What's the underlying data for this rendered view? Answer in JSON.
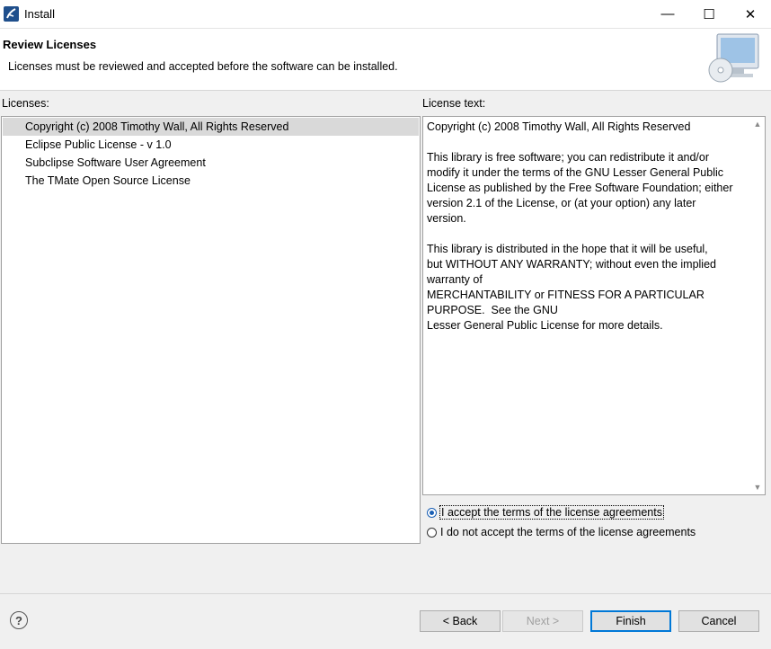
{
  "window": {
    "title": "Install",
    "controls": {
      "minimize": "—",
      "maximize": "☐",
      "close": "✕"
    }
  },
  "header": {
    "title": "Review Licenses",
    "description": "Licenses must be reviewed and accepted before the software can be installed."
  },
  "licenses": {
    "label": "Licenses:",
    "items": [
      {
        "label": "Copyright (c) 2008 Timothy Wall, All Rights Reserved",
        "selected": true
      },
      {
        "label": "Eclipse Public License - v 1.0",
        "selected": false
      },
      {
        "label": "Subclipse Software User Agreement",
        "selected": false
      },
      {
        "label": "The TMate Open Source License",
        "selected": false
      }
    ]
  },
  "license_text": {
    "label": "License text:",
    "content": "Copyright (c) 2008 Timothy Wall, All Rights Reserved\n\nThis library is free software; you can redistribute it and/or\nmodify it under the terms of the GNU Lesser General Public\nLicense as published by the Free Software Foundation; either\nversion 2.1 of the License, or (at your option) any later\nversion.\n\nThis library is distributed in the hope that it will be useful,\nbut WITHOUT ANY WARRANTY; without even the implied\nwarranty of\nMERCHANTABILITY or FITNESS FOR A PARTICULAR\nPURPOSE.  See the GNU\nLesser General Public License for more details."
  },
  "agreement": {
    "accept_label": "I accept the terms of the license agreements",
    "decline_label": "I do not accept the terms of the license agreements",
    "selected": "accept"
  },
  "buttons": {
    "back": "< Back",
    "next": "Next >",
    "finish": "Finish",
    "cancel": "Cancel"
  },
  "icons": {
    "app": "eclipse-icon",
    "banner": "computer-cd-icon",
    "help": "help-icon"
  },
  "colors": {
    "accent": "#0078d7",
    "selection": "#d9d9d9",
    "radio": "#1a5fb4"
  }
}
